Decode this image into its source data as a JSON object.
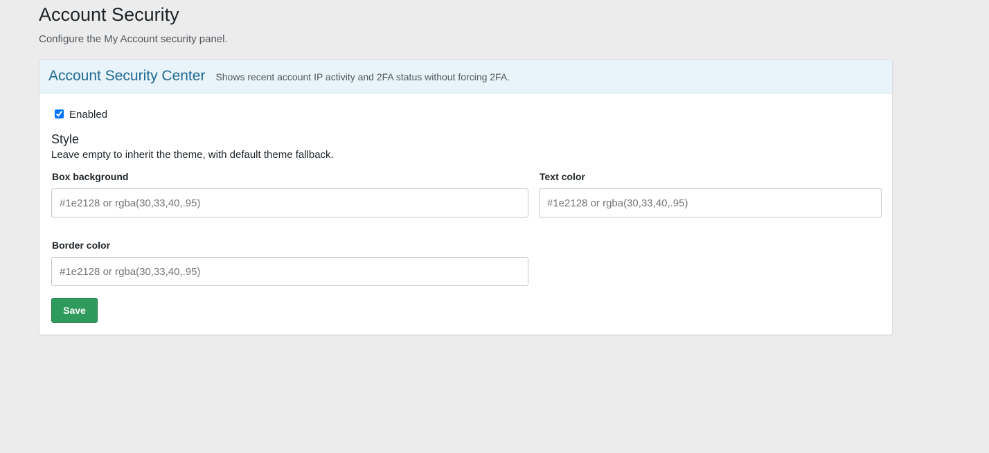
{
  "page": {
    "title": "Account Security",
    "description": "Configure the My Account security panel."
  },
  "card": {
    "title": "Account Security Center",
    "subtitle": "Shows recent account IP activity and 2FA status without forcing 2FA.",
    "enabled_label": "Enabled",
    "enabled_checked": true,
    "style_title": "Style",
    "style_description": "Leave empty to inherit the theme, with default theme fallback.",
    "fields": {
      "box_background": {
        "label": "Box background",
        "value": "",
        "placeholder": "#1e2128 or rgba(30,33,40,.95)"
      },
      "text_color": {
        "label": "Text color",
        "value": "",
        "placeholder": "#1e2128 or rgba(30,33,40,.95)"
      },
      "border_color": {
        "label": "Border color",
        "value": "",
        "placeholder": "#1e2128 or rgba(30,33,40,.95)"
      }
    },
    "save_label": "Save"
  },
  "colors": {
    "background": "#ececec",
    "header_bg": "#e8f3fa",
    "title_accent": "#1f6a93",
    "save_button": "#2e9a5c",
    "checkbox_accent": "#0075ff"
  }
}
